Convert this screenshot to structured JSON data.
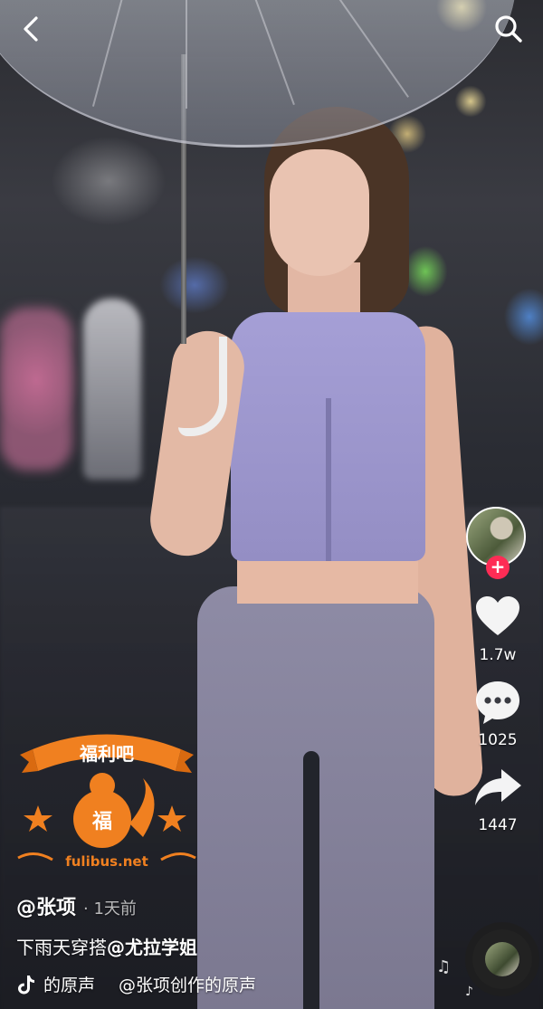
{
  "nav": {
    "back_icon": "chevron-left-icon",
    "search_icon": "search-icon"
  },
  "actions": {
    "follow_label": "+",
    "likes": "1.7w",
    "comments": "1025",
    "shares": "1447"
  },
  "watermark": {
    "banner_text": "福利吧",
    "badge_char": "福",
    "site": "fulibus.net",
    "color": "#f08020"
  },
  "post": {
    "author": "@张项",
    "time": "· 1天前",
    "caption_text": "下雨天穿搭",
    "caption_mention": "@尤拉学姐",
    "music_original": "的原声",
    "music_credit": "@张项创作的原声"
  },
  "colors": {
    "follow_accent": "#fe2c55",
    "icon_white": "#ffffff"
  }
}
